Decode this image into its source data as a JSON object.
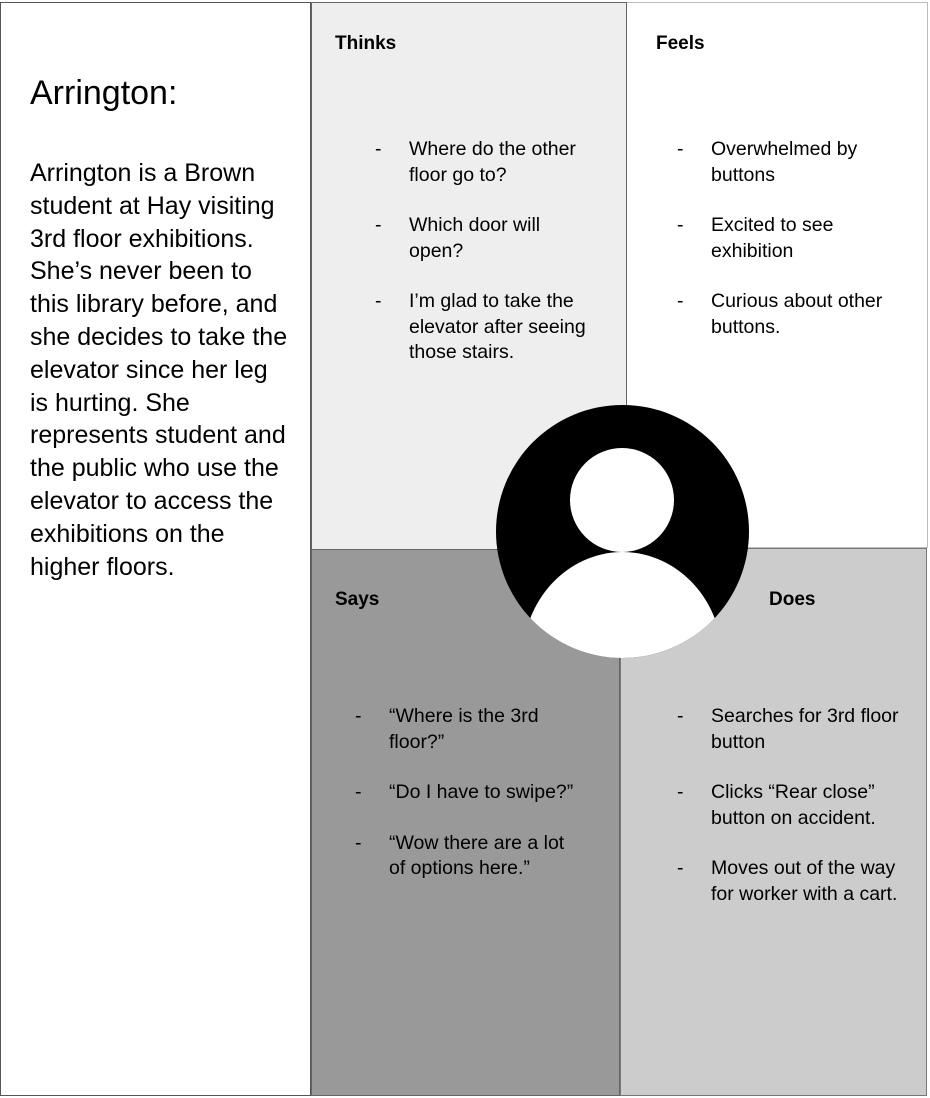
{
  "persona": {
    "name": "Arrington:",
    "description": "Arrington is a Brown student at Hay visiting 3rd floor exhibitions. She’s never been to this library before, and she decides to take the elevator since her leg is hurting. She represents student and the public who use the elevator to access the exhibitions on the higher floors."
  },
  "thinks": {
    "title": "Thinks",
    "items": [
      "Where do the other floor go to?",
      "Which door will open?",
      "I’m glad to take the elevator after seeing those stairs."
    ]
  },
  "feels": {
    "title": "Feels",
    "items": [
      "Overwhelmed by buttons",
      "Excited to see exhibition",
      "Curious about other buttons."
    ]
  },
  "says": {
    "title": "Says",
    "items": [
      "“Where is the 3rd floor?”",
      "“Do I have to swipe?”",
      "“Wow there are a lot of options here.”"
    ]
  },
  "does": {
    "title": "Does",
    "items": [
      "Searches for 3rd floor button",
      "Clicks “Rear close” button on accident.",
      "Moves out of the way for worker with a cart."
    ]
  },
  "bullet": "-",
  "avatar_icon": "user-avatar-icon",
  "colors": {
    "thinks_bg": "#eeeeee",
    "feels_bg": "#ffffff",
    "says_bg": "#999999",
    "does_bg": "#cccccc",
    "avatar": "#000000"
  }
}
